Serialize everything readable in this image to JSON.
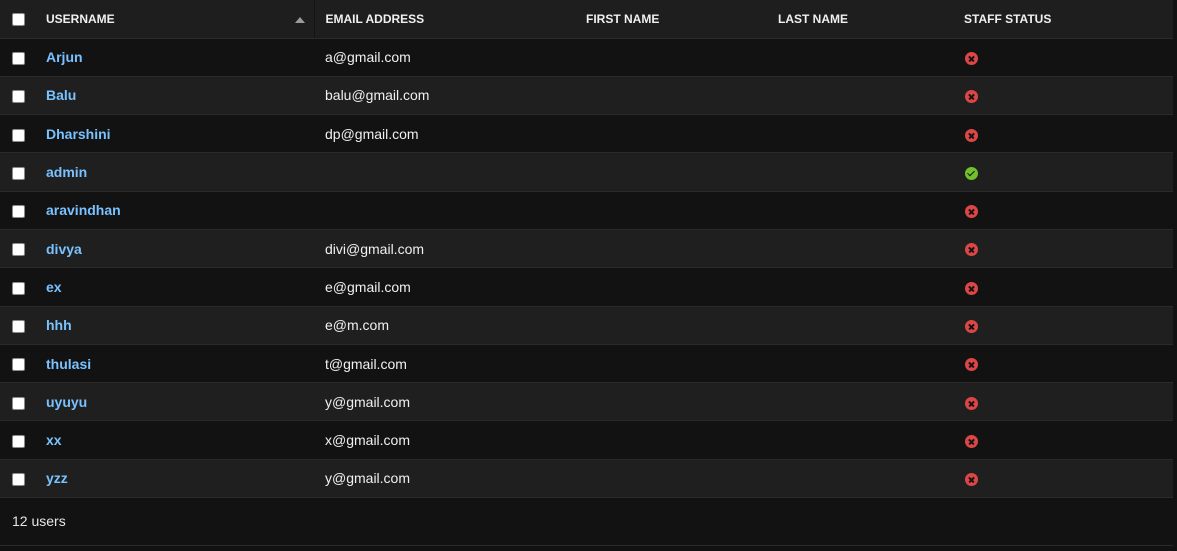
{
  "table": {
    "headers": {
      "username": "Username",
      "email": "Email address",
      "first_name": "First name",
      "last_name": "Last name",
      "staff_status": "Staff status"
    },
    "sort": {
      "column": "username",
      "direction": "ascending"
    },
    "rows": [
      {
        "username": "Arjun",
        "email": "a@gmail.com",
        "first_name": "",
        "last_name": "",
        "staff": false
      },
      {
        "username": "Balu",
        "email": "balu@gmail.com",
        "first_name": "",
        "last_name": "",
        "staff": false
      },
      {
        "username": "Dharshini",
        "email": "dp@gmail.com",
        "first_name": "",
        "last_name": "",
        "staff": false
      },
      {
        "username": "admin",
        "email": "",
        "first_name": "",
        "last_name": "",
        "staff": true
      },
      {
        "username": "aravindhan",
        "email": "",
        "first_name": "",
        "last_name": "",
        "staff": false
      },
      {
        "username": "divya",
        "email": "divi@gmail.com",
        "first_name": "",
        "last_name": "",
        "staff": false
      },
      {
        "username": "ex",
        "email": "e@gmail.com",
        "first_name": "",
        "last_name": "",
        "staff": false
      },
      {
        "username": "hhh",
        "email": "e@m.com",
        "first_name": "",
        "last_name": "",
        "staff": false
      },
      {
        "username": "thulasi",
        "email": "t@gmail.com",
        "first_name": "",
        "last_name": "",
        "staff": false
      },
      {
        "username": "uyuyu",
        "email": "y@gmail.com",
        "first_name": "",
        "last_name": "",
        "staff": false
      },
      {
        "username": "xx",
        "email": "x@gmail.com",
        "first_name": "",
        "last_name": "",
        "staff": false
      },
      {
        "username": "yzz",
        "email": "y@gmail.com",
        "first_name": "",
        "last_name": "",
        "staff": false
      }
    ]
  },
  "footer": {
    "count_text": "12 users"
  },
  "icons": {
    "staff_true": "check-circle-icon",
    "staff_false": "x-circle-icon",
    "sort": "sort-ascending-icon"
  },
  "colors": {
    "link": "#79c2ff",
    "staff_true": "#70bf2b",
    "staff_false": "#dd4646"
  }
}
